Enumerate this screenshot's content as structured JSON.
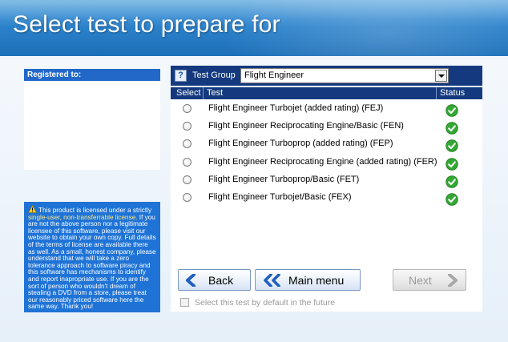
{
  "header": {
    "title": "Select test to prepare for"
  },
  "registered": {
    "label": "Registered to:"
  },
  "license": {
    "part1": "This product is licensed under a strictly ",
    "highlight": "single-user, non-transferrable license.",
    "part2": " If you are not the above person nor a legitimate licensee of this software, please visit our website to obtain your own copy. Full details of the terms of license are available there as well. As a small, honest company, please understand that we will take a zero tolerance approach to software piracy and this software has mechanisms to identify and report inapropriate use. If you are the sort of person who wouldn't dream of stealing a DVD from a store, please treat our reasonably priced software here the same way. Thank you!"
  },
  "group": {
    "help": "?",
    "label": "Test Group",
    "selected": "Flight Engineer"
  },
  "table": {
    "col_select": "Select",
    "col_test": "Test",
    "col_status": "Status",
    "rows": [
      {
        "label": "Flight Engineer Turbojet (added rating) (FEJ)",
        "status": "ok"
      },
      {
        "label": "Flight Engineer Reciprocating Engine/Basic (FEN)",
        "status": "ok"
      },
      {
        "label": "Flight Engineer Turboprop (added rating) (FEP)",
        "status": "ok"
      },
      {
        "label": "Flight Engineer Reciprocating Engine (added rating) (FER)",
        "status": "ok"
      },
      {
        "label": "Flight Engineer Turboprop/Basic (FET)",
        "status": "ok"
      },
      {
        "label": "Flight Engineer Turbojet/Basic (FEX)",
        "status": "ok"
      }
    ]
  },
  "buttons": {
    "back": "Back",
    "main_menu": "Main menu",
    "next": "Next"
  },
  "default_checkbox": {
    "label": "Select this test by default in the future"
  },
  "colors": {
    "header": "#1c6fb8",
    "panel_bar": "#14397f",
    "license_bg": "#1f73d6",
    "status_ok": "#2e9d2e"
  }
}
